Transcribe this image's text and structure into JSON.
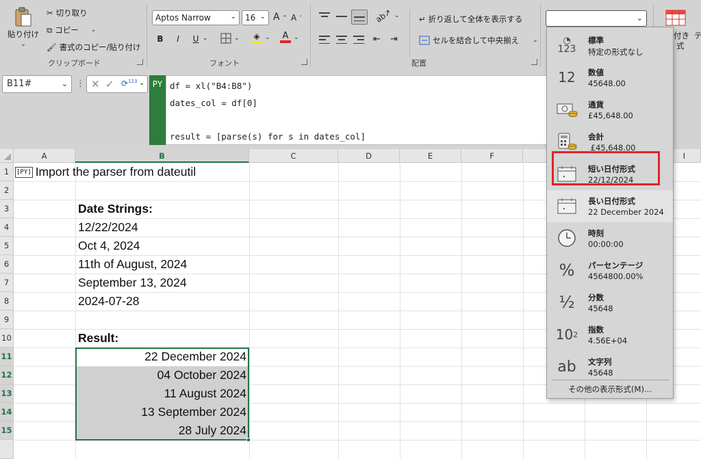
{
  "ribbon": {
    "clipboard": {
      "paste": "貼り付け",
      "cut": "切り取り",
      "copy": "コピー",
      "format_painter": "書式のコピー/貼り付け",
      "group_label": "クリップボード"
    },
    "font": {
      "family": "Aptos Narrow",
      "size": "16",
      "bold": "B",
      "italic": "I",
      "underline": "U",
      "group_label": "フォント",
      "fill_color": "#ffe600",
      "font_color": "#e0242c"
    },
    "alignment": {
      "wrap_text": "折り返して全体を表示する",
      "merge_center": "セルを結合して中央揃え",
      "group_label": "配置"
    },
    "right_partial": {
      "line1": "付き",
      "line2": "式",
      "line3": "テ"
    }
  },
  "formula_bar": {
    "name_box": "B11#",
    "py_label": "PY",
    "code_lines": [
      "df = xl(\"B4:B8\")",
      "dates_col = df[0]",
      "",
      "result = [parse(s) for s in dates_col]"
    ]
  },
  "sheet": {
    "columns": [
      "A",
      "B",
      "C",
      "D",
      "E",
      "F",
      "G",
      "H",
      "I"
    ],
    "rows": [
      "1",
      "2",
      "3",
      "4",
      "5",
      "6",
      "7",
      "8",
      "9",
      "10",
      "11",
      "12",
      "13",
      "14",
      "15"
    ],
    "a1_badge": "[PY]",
    "cells": {
      "a1": "Import the parser from dateutil",
      "b3": "Date Strings:",
      "b4": "12/22/2024",
      "b5": "Oct 4, 2024",
      "b6": "11th of August, 2024",
      "b7": "September 13, 2024",
      "b8": "2024-07-28",
      "b10": "Result:",
      "b11": "22 December 2024",
      "b12": "04 October 2024",
      "b13": "11 August 2024",
      "b14": "13 September 2024",
      "b15": "28 July 2024"
    }
  },
  "number_format": {
    "combo_value": "",
    "items": [
      {
        "name": "標準",
        "example": "特定の形式なし",
        "icon": "clock-123-icon"
      },
      {
        "name": "数値",
        "example": "45648.00",
        "icon": "number-12-icon"
      },
      {
        "name": "通貨",
        "example": "£45,648.00",
        "icon": "currency-icon"
      },
      {
        "name": "会計",
        "example": " £45,648.00",
        "icon": "calculator-icon"
      },
      {
        "name": "短い日付形式",
        "example": "22/12/2024",
        "icon": "calendar-icon"
      },
      {
        "name": "長い日付形式",
        "example": "22 December 2024",
        "icon": "calendar-icon"
      },
      {
        "name": "時刻",
        "example": "00:00:00",
        "icon": "clock-icon"
      },
      {
        "name": "パーセンテージ",
        "example": "4564800.00%",
        "icon": "percent-icon"
      },
      {
        "name": "分数",
        "example": "45648",
        "icon": "fraction-icon"
      },
      {
        "name": "指数",
        "example": "4.56E+04",
        "icon": "exponent-icon"
      },
      {
        "name": "文字列",
        "example": "45648",
        "icon": "text-ab-icon"
      }
    ],
    "footer": "その他の表示形式(M)...",
    "highlight_color": "#e0242c"
  }
}
